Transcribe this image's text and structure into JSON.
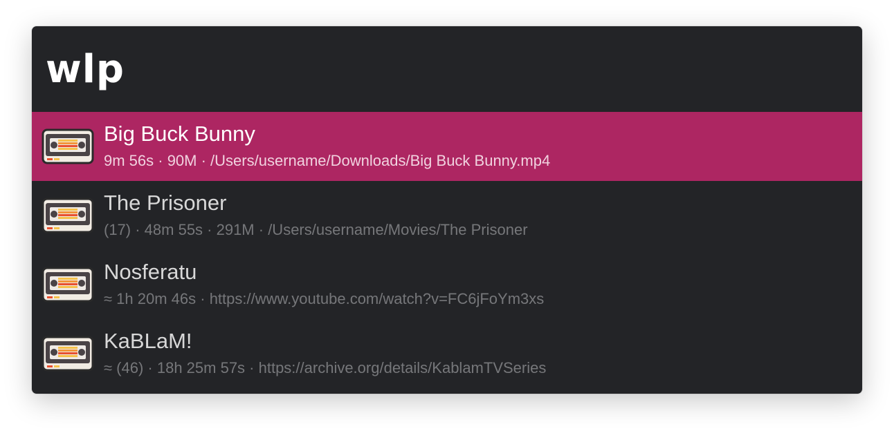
{
  "query": {
    "value": "wlp"
  },
  "results": [
    {
      "title": "Big Buck Bunny",
      "subtitle": "9m 56s · 90M · /Users/username/Downloads/Big Buck Bunny.mp4",
      "icon": "vhs-tape-icon",
      "selected": true
    },
    {
      "title": "The Prisoner",
      "subtitle": "(17) · 48m 55s · 291M · /Users/username/Movies/The Prisoner",
      "icon": "vhs-tape-icon",
      "selected": false
    },
    {
      "title": "Nosferatu",
      "subtitle": "≈ 1h 20m 46s · https://www.youtube.com/watch?v=FC6jFoYm3xs",
      "icon": "vhs-tape-icon",
      "selected": false
    },
    {
      "title": "KaBLaM!",
      "subtitle": "≈ (46) · 18h 25m 57s · https://archive.org/details/KablamTVSeries",
      "icon": "vhs-tape-icon",
      "selected": false
    }
  ],
  "colors": {
    "window_background": "#232427",
    "selection": "#ad2662",
    "title_text": "#d8d8d8",
    "subtitle_text": "#76777a"
  }
}
